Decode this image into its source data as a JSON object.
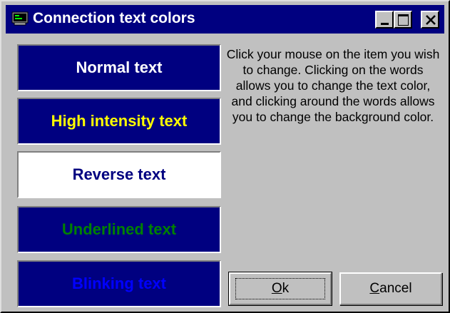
{
  "window": {
    "title": "Connection text colors"
  },
  "samples": [
    {
      "label": "Normal text",
      "text_color": "#ffffff",
      "background_color": "#000080"
    },
    {
      "label": "High intensity text",
      "text_color": "#ffff00",
      "background_color": "#000080"
    },
    {
      "label": "Reverse text",
      "text_color": "#000080",
      "background_color": "#ffffff"
    },
    {
      "label": "Underlined text",
      "text_color": "#008000",
      "background_color": "#000080"
    },
    {
      "label": "Blinking text",
      "text_color": "#0000ff",
      "background_color": "#000080"
    }
  ],
  "instructions": "Click your mouse on the item you wish to change. Clicking on the words allows you to change the text color, and clicking around the words allows you to change the background color.",
  "buttons": {
    "ok": "Ok",
    "cancel": "Cancel"
  },
  "icons": {
    "title": "terminal-icon",
    "minimize": "minimize-icon",
    "maximize": "maximize-icon",
    "close": "close-icon"
  }
}
